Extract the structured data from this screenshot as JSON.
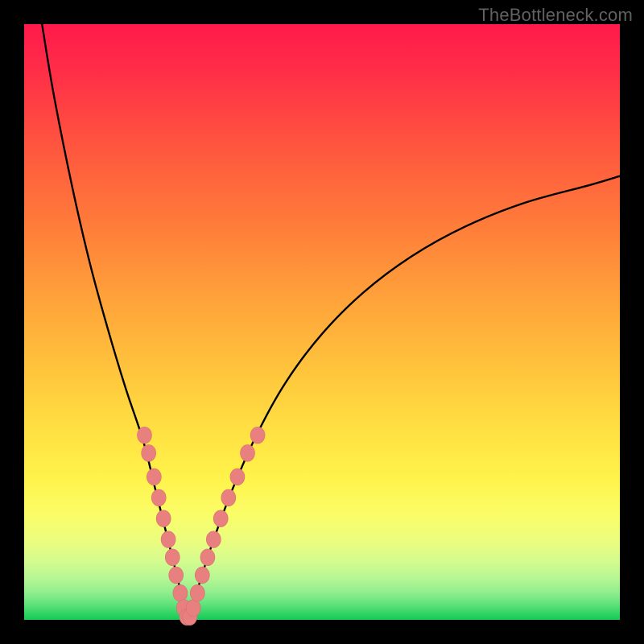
{
  "watermark": "TheBottleneck.com",
  "colors": {
    "background_frame": "#000000",
    "gradient_top": "#ff1a4b",
    "gradient_bottom": "#16c956",
    "curve": "#000000",
    "marker_fill": "#e98080",
    "marker_stroke": "#d86e6e"
  },
  "chart_data": {
    "type": "line",
    "title": "",
    "xlabel": "",
    "ylabel": "",
    "xlim": [
      0,
      100
    ],
    "ylim": [
      0,
      100
    ],
    "curve": {
      "left_branch_x": [
        3,
        5,
        8,
        11,
        14,
        17,
        20,
        22,
        24,
        25.5,
        26.7,
        27.5
      ],
      "left_branch_y": [
        100,
        88,
        73,
        60,
        49,
        39,
        30,
        22,
        14,
        8,
        3,
        0
      ],
      "right_branch_x": [
        27.5,
        28.5,
        30,
        32,
        35,
        39,
        44,
        50,
        57,
        65,
        74,
        84,
        95,
        100
      ],
      "right_branch_y": [
        0,
        3,
        8,
        14,
        22,
        31,
        40,
        48,
        55,
        61,
        66,
        70,
        73,
        74.5
      ]
    },
    "markers_left_branch": [
      {
        "x": 20.2,
        "y": 31.0
      },
      {
        "x": 20.9,
        "y": 28.0
      },
      {
        "x": 21.8,
        "y": 24.0
      },
      {
        "x": 22.6,
        "y": 20.5
      },
      {
        "x": 23.4,
        "y": 17.0
      },
      {
        "x": 24.2,
        "y": 13.5
      },
      {
        "x": 24.9,
        "y": 10.5
      },
      {
        "x": 25.5,
        "y": 7.5
      },
      {
        "x": 26.2,
        "y": 4.5
      },
      {
        "x": 26.8,
        "y": 2.0
      },
      {
        "x": 27.3,
        "y": 0.5
      }
    ],
    "markers_right_branch": [
      {
        "x": 27.8,
        "y": 0.5
      },
      {
        "x": 28.4,
        "y": 2.0
      },
      {
        "x": 29.1,
        "y": 4.5
      },
      {
        "x": 29.9,
        "y": 7.5
      },
      {
        "x": 30.8,
        "y": 10.5
      },
      {
        "x": 31.8,
        "y": 13.5
      },
      {
        "x": 33.0,
        "y": 17.0
      },
      {
        "x": 34.3,
        "y": 20.5
      },
      {
        "x": 35.8,
        "y": 24.0
      },
      {
        "x": 37.5,
        "y": 28.0
      },
      {
        "x": 39.2,
        "y": 31.0
      }
    ],
    "marker_radius_px": 9
  }
}
